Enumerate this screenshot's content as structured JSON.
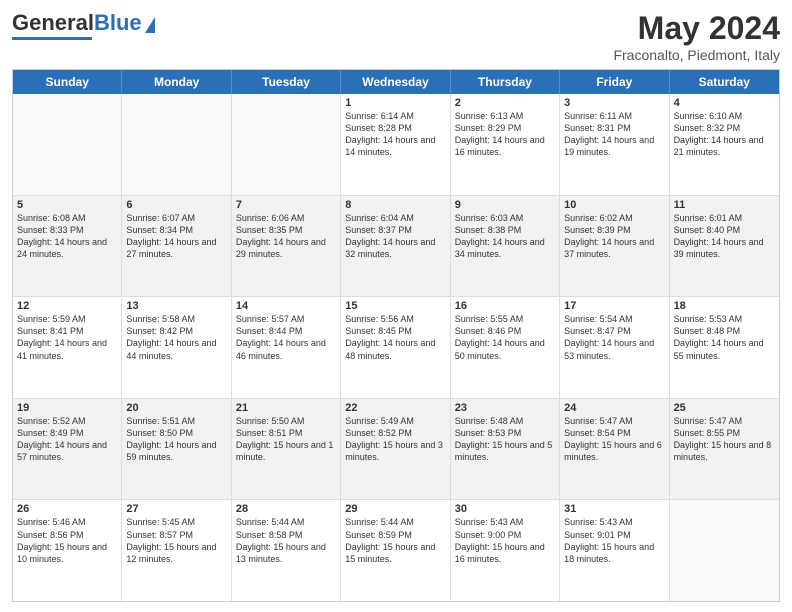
{
  "header": {
    "logo": "GeneralBlue",
    "title": "May 2024",
    "subtitle": "Fraconalto, Piedmont, Italy"
  },
  "days": [
    "Sunday",
    "Monday",
    "Tuesday",
    "Wednesday",
    "Thursday",
    "Friday",
    "Saturday"
  ],
  "rows": [
    [
      {
        "day": "",
        "info": ""
      },
      {
        "day": "",
        "info": ""
      },
      {
        "day": "",
        "info": ""
      },
      {
        "day": "1",
        "info": "Sunrise: 6:14 AM\nSunset: 8:28 PM\nDaylight: 14 hours and 14 minutes."
      },
      {
        "day": "2",
        "info": "Sunrise: 6:13 AM\nSunset: 8:29 PM\nDaylight: 14 hours and 16 minutes."
      },
      {
        "day": "3",
        "info": "Sunrise: 6:11 AM\nSunset: 8:31 PM\nDaylight: 14 hours and 19 minutes."
      },
      {
        "day": "4",
        "info": "Sunrise: 6:10 AM\nSunset: 8:32 PM\nDaylight: 14 hours and 21 minutes."
      }
    ],
    [
      {
        "day": "5",
        "info": "Sunrise: 6:08 AM\nSunset: 8:33 PM\nDaylight: 14 hours and 24 minutes."
      },
      {
        "day": "6",
        "info": "Sunrise: 6:07 AM\nSunset: 8:34 PM\nDaylight: 14 hours and 27 minutes."
      },
      {
        "day": "7",
        "info": "Sunrise: 6:06 AM\nSunset: 8:35 PM\nDaylight: 14 hours and 29 minutes."
      },
      {
        "day": "8",
        "info": "Sunrise: 6:04 AM\nSunset: 8:37 PM\nDaylight: 14 hours and 32 minutes."
      },
      {
        "day": "9",
        "info": "Sunrise: 6:03 AM\nSunset: 8:38 PM\nDaylight: 14 hours and 34 minutes."
      },
      {
        "day": "10",
        "info": "Sunrise: 6:02 AM\nSunset: 8:39 PM\nDaylight: 14 hours and 37 minutes."
      },
      {
        "day": "11",
        "info": "Sunrise: 6:01 AM\nSunset: 8:40 PM\nDaylight: 14 hours and 39 minutes."
      }
    ],
    [
      {
        "day": "12",
        "info": "Sunrise: 5:59 AM\nSunset: 8:41 PM\nDaylight: 14 hours and 41 minutes."
      },
      {
        "day": "13",
        "info": "Sunrise: 5:58 AM\nSunset: 8:42 PM\nDaylight: 14 hours and 44 minutes."
      },
      {
        "day": "14",
        "info": "Sunrise: 5:57 AM\nSunset: 8:44 PM\nDaylight: 14 hours and 46 minutes."
      },
      {
        "day": "15",
        "info": "Sunrise: 5:56 AM\nSunset: 8:45 PM\nDaylight: 14 hours and 48 minutes."
      },
      {
        "day": "16",
        "info": "Sunrise: 5:55 AM\nSunset: 8:46 PM\nDaylight: 14 hours and 50 minutes."
      },
      {
        "day": "17",
        "info": "Sunrise: 5:54 AM\nSunset: 8:47 PM\nDaylight: 14 hours and 53 minutes."
      },
      {
        "day": "18",
        "info": "Sunrise: 5:53 AM\nSunset: 8:48 PM\nDaylight: 14 hours and 55 minutes."
      }
    ],
    [
      {
        "day": "19",
        "info": "Sunrise: 5:52 AM\nSunset: 8:49 PM\nDaylight: 14 hours and 57 minutes."
      },
      {
        "day": "20",
        "info": "Sunrise: 5:51 AM\nSunset: 8:50 PM\nDaylight: 14 hours and 59 minutes."
      },
      {
        "day": "21",
        "info": "Sunrise: 5:50 AM\nSunset: 8:51 PM\nDaylight: 15 hours and 1 minute."
      },
      {
        "day": "22",
        "info": "Sunrise: 5:49 AM\nSunset: 8:52 PM\nDaylight: 15 hours and 3 minutes."
      },
      {
        "day": "23",
        "info": "Sunrise: 5:48 AM\nSunset: 8:53 PM\nDaylight: 15 hours and 5 minutes."
      },
      {
        "day": "24",
        "info": "Sunrise: 5:47 AM\nSunset: 8:54 PM\nDaylight: 15 hours and 6 minutes."
      },
      {
        "day": "25",
        "info": "Sunrise: 5:47 AM\nSunset: 8:55 PM\nDaylight: 15 hours and 8 minutes."
      }
    ],
    [
      {
        "day": "26",
        "info": "Sunrise: 5:46 AM\nSunset: 8:56 PM\nDaylight: 15 hours and 10 minutes."
      },
      {
        "day": "27",
        "info": "Sunrise: 5:45 AM\nSunset: 8:57 PM\nDaylight: 15 hours and 12 minutes."
      },
      {
        "day": "28",
        "info": "Sunrise: 5:44 AM\nSunset: 8:58 PM\nDaylight: 15 hours and 13 minutes."
      },
      {
        "day": "29",
        "info": "Sunrise: 5:44 AM\nSunset: 8:59 PM\nDaylight: 15 hours and 15 minutes."
      },
      {
        "day": "30",
        "info": "Sunrise: 5:43 AM\nSunset: 9:00 PM\nDaylight: 15 hours and 16 minutes."
      },
      {
        "day": "31",
        "info": "Sunrise: 5:43 AM\nSunset: 9:01 PM\nDaylight: 15 hours and 18 minutes."
      },
      {
        "day": "",
        "info": ""
      }
    ]
  ]
}
